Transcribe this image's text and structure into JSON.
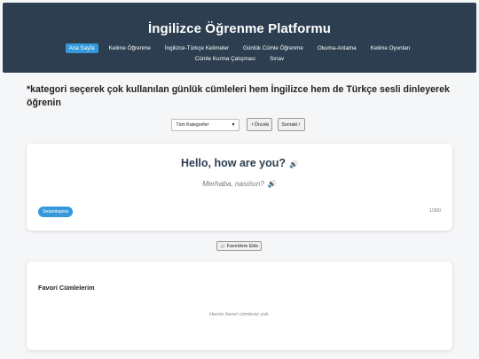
{
  "header": {
    "title": "İngilizce Öğrenme Platformu",
    "nav_row1": [
      {
        "label": "Ana Sayfa",
        "active": true
      },
      {
        "label": "Kelime Öğrenme",
        "active": false
      },
      {
        "label": "İngilizce-Türkçe Kelimeler",
        "active": false
      },
      {
        "label": "Günlük Cümle Öğrenme",
        "active": false
      },
      {
        "label": "Okuma-Anlama",
        "active": false
      },
      {
        "label": "Kelime Oyunları",
        "active": false
      }
    ],
    "nav_row2": [
      {
        "label": "Cümle Kurma Çalışması",
        "active": false
      },
      {
        "label": "Sınav",
        "active": false
      }
    ],
    "accent_color": "#3498db",
    "background_color": "#2c3e50"
  },
  "main": {
    "heading": "*kategori seçerek çok kullanılan günlük cümleleri hem İngilizce hem de Türkçe sesli dinleyerek öğrenin",
    "controls": {
      "category_select": "Tüm Kategoriler",
      "prev_label": "Önceki",
      "next_label": "Sonraki",
      "prev_icon": "chevron-left-icon",
      "next_icon": "chevron-right-icon"
    },
    "card": {
      "english": "Hello, how are you?",
      "turkish": "Merhaba, nasılsın?",
      "category": "Selamlaşma",
      "counter": "1/360",
      "speaker_icon": "speaker-icon"
    },
    "favorite_button": "Favorilere Ekle",
    "favorites": {
      "title": "Favori Cümlelerim",
      "empty_text": "Henüz favori cümleniz yok."
    }
  }
}
